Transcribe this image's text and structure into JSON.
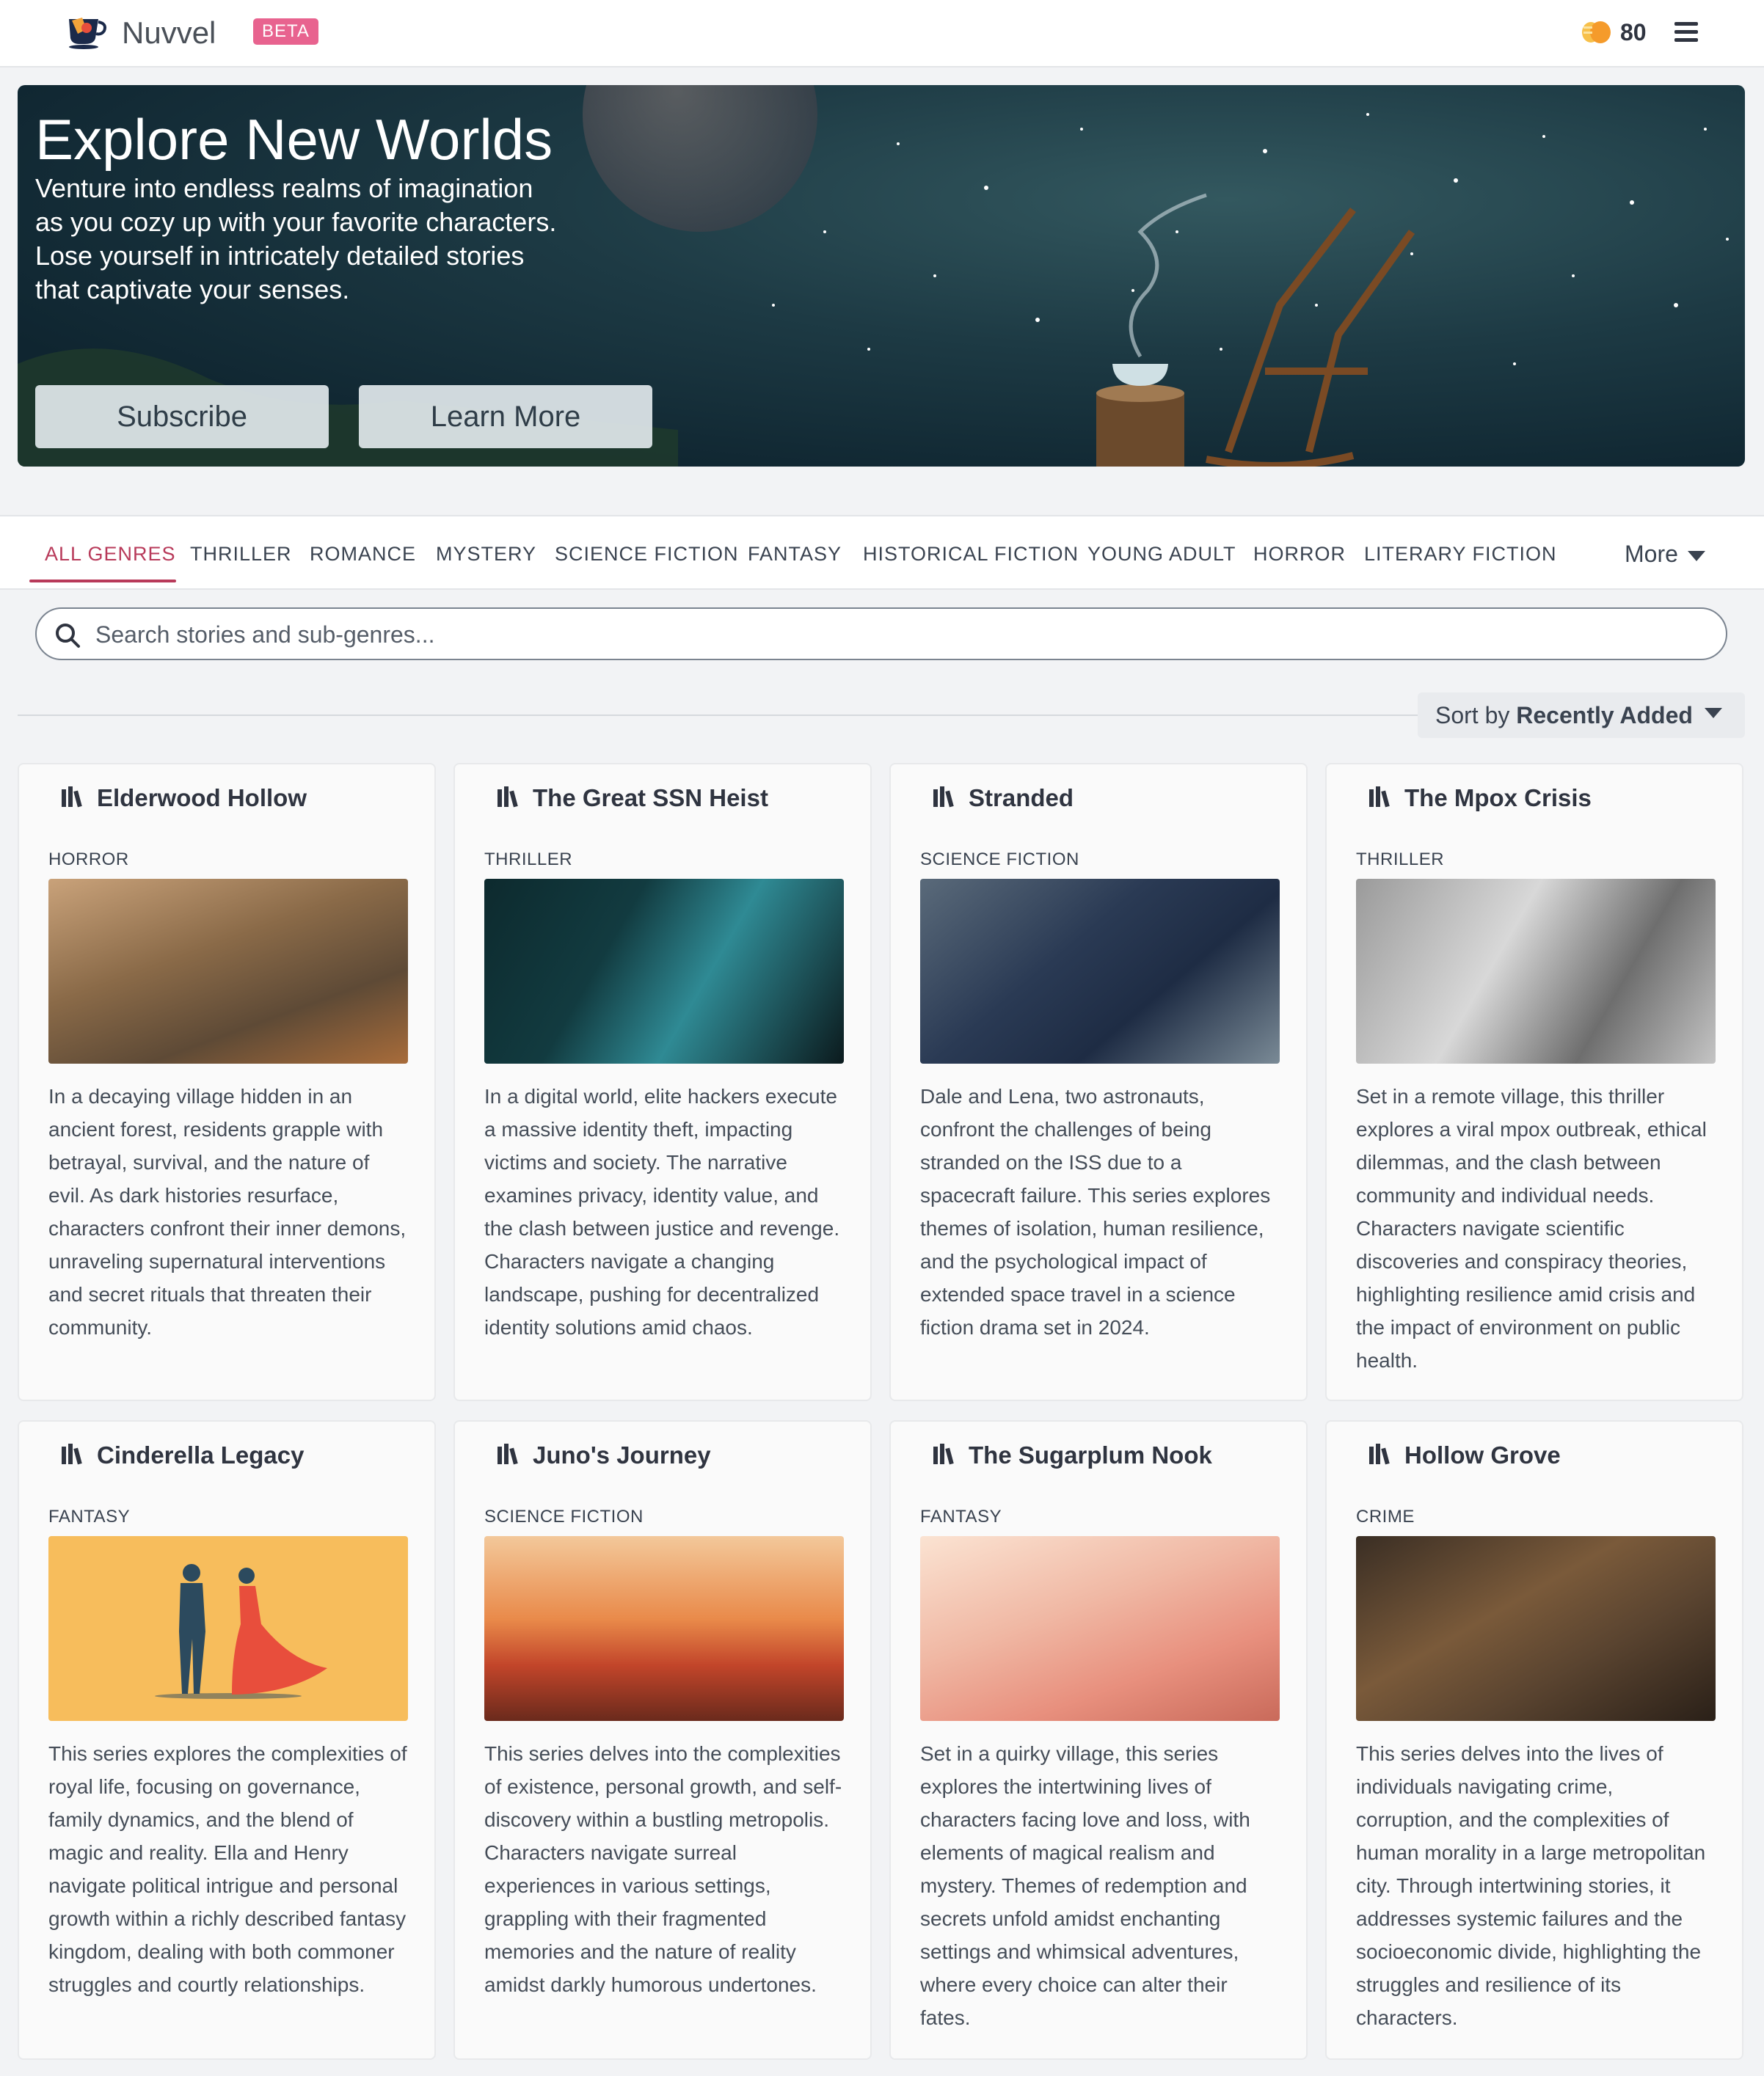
{
  "header": {
    "brand": "Nuvvel",
    "badge": "BETA",
    "coin_count": "80",
    "icons": [
      "teacup-logo-icon",
      "coins-icon",
      "hamburger-menu-icon"
    ]
  },
  "hero": {
    "title": "Explore New Worlds",
    "description": "Venture into endless realms of imagination as you cozy up with your favorite characters. Lose yourself in intricately detailed stories that captivate your senses.",
    "subscribe_label": "Subscribe",
    "learn_more_label": "Learn More"
  },
  "genres": {
    "tabs": [
      "ALL GENRES",
      "THRILLER",
      "ROMANCE",
      "MYSTERY",
      "SCIENCE FICTION",
      "FANTASY",
      "HISTORICAL FICTION",
      "YOUNG ADULT",
      "HORROR",
      "LITERARY FICTION"
    ],
    "active": "ALL GENRES",
    "more_label": "More"
  },
  "search": {
    "placeholder": "Search stories and sub-genres..."
  },
  "sort": {
    "prefix": "Sort by",
    "value": "Recently Added"
  },
  "stories": [
    {
      "title": "Elderwood Hollow",
      "genre": "HORROR",
      "description": "In a decaying village hidden in an ancient forest, residents grapple with betrayal, survival, and the nature of evil. As dark histories resurface, characters confront their inner demons, unraveling supernatural interventions and secret rituals that threaten their community."
    },
    {
      "title": "The Great SSN Heist",
      "genre": "THRILLER",
      "description": "In a digital world, elite hackers execute a massive identity theft, impacting victims and society. The narrative examines privacy, identity value, and the clash between justice and revenge. Characters navigate a changing landscape, pushing for decentralized identity solutions amid chaos."
    },
    {
      "title": "Stranded",
      "genre": "SCIENCE FICTION",
      "description": "Dale and Lena, two astronauts, confront the challenges of being stranded on the ISS due to a spacecraft failure. This series explores themes of isolation, human resilience, and the psychological impact of extended space travel in a science fiction drama set in 2024."
    },
    {
      "title": "The Mpox Crisis",
      "genre": "THRILLER",
      "description": "Set in a remote village, this thriller explores a viral mpox outbreak, ethical dilemmas, and the clash between community and individual needs. Characters navigate scientific discoveries and conspiracy theories, highlighting resilience amid crisis and the impact of environment on public health."
    },
    {
      "title": "Cinderella Legacy",
      "genre": "FANTASY",
      "description": "This series explores the complexities of royal life, focusing on governance, family dynamics, and the blend of magic and reality. Ella and Henry navigate political intrigue and personal growth within a richly described fantasy kingdom, dealing with both commoner struggles and courtly relationships."
    },
    {
      "title": "Juno's Journey",
      "genre": "SCIENCE FICTION",
      "description": "This series delves into the complexities of existence, personal growth, and self-discovery within a bustling metropolis. Characters navigate surreal experiences in various settings, grappling with their fragmented memories and the nature of reality amidst darkly humorous undertones."
    },
    {
      "title": "The Sugarplum Nook",
      "genre": "FANTASY",
      "description": "Set in a quirky village, this series explores the intertwining lives of characters facing love and loss, with elements of magical realism and mystery. Themes of redemption and secrets unfold amidst enchanting settings and whimsical adventures, where every choice can alter their fates."
    },
    {
      "title": "Hollow Grove",
      "genre": "CRIME",
      "description": "This series delves into the lives of individuals navigating crime, corruption, and the complexities of human morality in a large metropolitan city. Through intertwining stories, it addresses systemic failures and the socioeconomic divide, highlighting the struggles and resilience of its characters."
    }
  ],
  "colors": {
    "accent": "#b83a5a",
    "beta_badge": "#e8638f",
    "coin": "#f59b2b"
  }
}
